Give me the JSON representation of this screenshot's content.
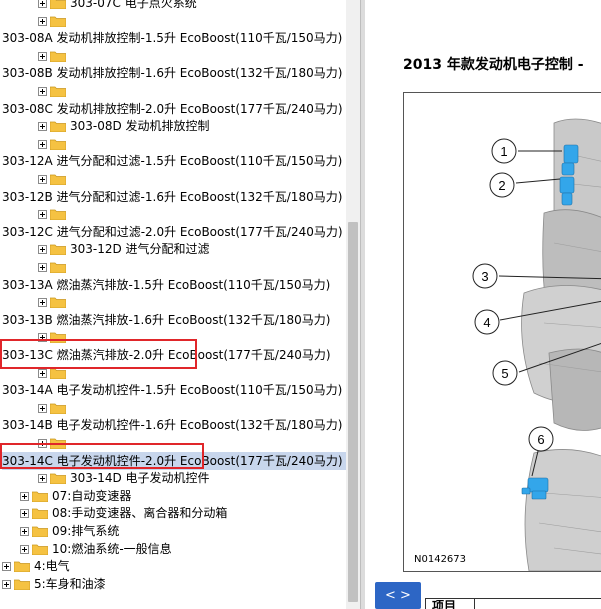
{
  "tree": {
    "items": [
      {
        "label": "303-07C 电子点火系统",
        "level": 2,
        "kind": "sub"
      },
      {
        "label": "",
        "level": 1,
        "kind": "folder"
      },
      {
        "label": "303-08A 发动机排放控制-1.5升 EcoBoost(110千瓦/150马力)",
        "level": 0,
        "kind": "text"
      },
      {
        "label": "",
        "level": 1,
        "kind": "folder"
      },
      {
        "label": "303-08B 发动机排放控制-1.6升 EcoBoost(132千瓦/180马力)",
        "level": 0,
        "kind": "text"
      },
      {
        "label": "",
        "level": 1,
        "kind": "folder"
      },
      {
        "label": "303-08C 发动机排放控制-2.0升 EcoBoost(177千瓦/240马力)",
        "level": 0,
        "kind": "text"
      },
      {
        "label": "303-08D 发动机排放控制",
        "level": 1,
        "kind": "sub"
      },
      {
        "label": "",
        "level": 1,
        "kind": "folder"
      },
      {
        "label": "303-12A 进气分配和过滤-1.5升 EcoBoost(110千瓦/150马力)",
        "level": 0,
        "kind": "text"
      },
      {
        "label": "",
        "level": 1,
        "kind": "folder"
      },
      {
        "label": "303-12B 进气分配和过滤-1.6升 EcoBoost(132千瓦/180马力)",
        "level": 0,
        "kind": "text"
      },
      {
        "label": "",
        "level": 1,
        "kind": "folder"
      },
      {
        "label": "303-12C 进气分配和过滤-2.0升 EcoBoost(177千瓦/240马力)",
        "level": 0,
        "kind": "text"
      },
      {
        "label": "303-12D 进气分配和过滤",
        "level": 1,
        "kind": "sub"
      },
      {
        "label": "",
        "level": 1,
        "kind": "folder"
      },
      {
        "label": "303-13A 燃油蒸汽排放-1.5升 EcoBoost(110千瓦/150马力)",
        "level": 0,
        "kind": "text"
      },
      {
        "label": "",
        "level": 1,
        "kind": "folder"
      },
      {
        "label": "303-13B 燃油蒸汽排放-1.6升 EcoBoost(132千瓦/180马力)",
        "level": 0,
        "kind": "text"
      },
      {
        "label": "",
        "level": 1,
        "kind": "folder"
      },
      {
        "label": "303-13C 燃油蒸汽排放-2.0升 EcoBoost(177千瓦/240马力)",
        "level": 0,
        "kind": "text"
      },
      {
        "label": "",
        "level": 1,
        "kind": "folder"
      },
      {
        "label": "303-14A 电子发动机控件-1.5升 EcoBoost(110千瓦/150马力)",
        "level": 0,
        "kind": "text"
      },
      {
        "label": "",
        "level": 1,
        "kind": "folder"
      },
      {
        "label": "303-14B 电子发动机控件-1.6升 EcoBoost(132千瓦/180马力)",
        "level": 0,
        "kind": "text"
      },
      {
        "label": "",
        "level": 1,
        "kind": "folder"
      },
      {
        "label": "303-14C 电子发动机控件-2.0升 EcoBoost(177千瓦/240马力)",
        "level": 0,
        "kind": "text",
        "selected": true
      },
      {
        "label": "303-14D 电子发动机控件",
        "level": 1,
        "kind": "sub"
      },
      {
        "label": "07:自动变速器",
        "level": 0,
        "kind": "group"
      },
      {
        "label": "08:手动变速器、离合器和分动箱",
        "level": 0,
        "kind": "group"
      },
      {
        "label": "09:排气系统",
        "level": 0,
        "kind": "group"
      },
      {
        "label": "10:燃油系统-一般信息",
        "level": 0,
        "kind": "group"
      },
      {
        "label": "4:电气",
        "level": -1,
        "kind": "group"
      },
      {
        "label": "5:车身和油漆",
        "level": -1,
        "kind": "group"
      }
    ]
  },
  "document": {
    "title": "2013 年款发动机电子控制 - ",
    "figure_code": "N0142673",
    "callouts": [
      "1",
      "2",
      "3",
      "4",
      "5",
      "6"
    ],
    "nav_button": "< >",
    "table_header": "项目"
  },
  "colors": {
    "folder": "#f5c242",
    "selection": "#c8d6ec",
    "highlight_box": "#e0262a",
    "nav_button": "#2d66c5",
    "part_blue": "#33a6ea"
  }
}
